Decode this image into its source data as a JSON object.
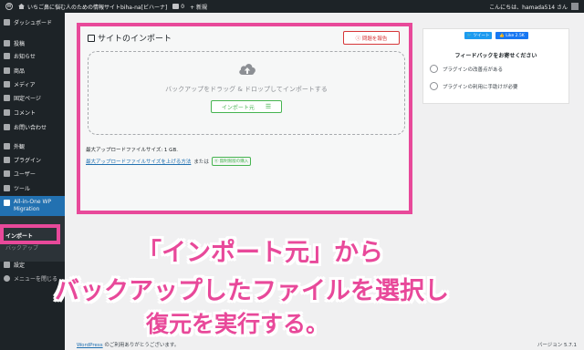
{
  "adminbar": {
    "site_name": "いちご鼻に悩む人のための情報サイトbiha-na[ビハーナ]",
    "comments_count": "0",
    "new_label": "+ 新規",
    "greeting": "こんにちは、hamada514 さん"
  },
  "sidebar": {
    "items": [
      {
        "label": "ダッシュボード"
      },
      {
        "label": "投稿"
      },
      {
        "label": "お知らせ"
      },
      {
        "label": "商品"
      },
      {
        "label": "メディア"
      },
      {
        "label": "固定ページ"
      },
      {
        "label": "コメント"
      },
      {
        "label": "お問い合わせ"
      },
      {
        "label": "外観"
      },
      {
        "label": "プラグイン"
      },
      {
        "label": "ユーザー"
      },
      {
        "label": "ツール"
      },
      {
        "label": "All-in-One WP Migration"
      }
    ],
    "submenu": {
      "import": "インポート",
      "backups": "バックアップ"
    },
    "settings": "設定",
    "collapse": "メニューを閉じる"
  },
  "main": {
    "title": "サイトのインポート",
    "report_button": "ⓘ 問題を報告",
    "drop_text": "バックアップをドラッグ & ドロップしてインポートする",
    "import_from_button": "インポート元",
    "max_size_text": "最大アップロードファイルサイズ: 1 GB.",
    "max_size_link": "最大アップロードファイルサイズを上げる方法",
    "or_text": "または",
    "unlimited_badge": "⓪ 無制限版の購入"
  },
  "feedback": {
    "tweet": "🐦 ツイート",
    "like": "👍 Like 2.5K",
    "title": "フィードバックをお寄せください",
    "options": [
      "プラグインの改善点がある",
      "プラグインの利用に手助けが必要"
    ]
  },
  "captions": {
    "line1": "「インポート元」から",
    "line2": "バックアップしたファイルを選択し",
    "line3": "復元を実行する。"
  },
  "footer": {
    "wordpress_link": "WordPress",
    "thanks": " のご利用ありがとうございます。",
    "version": "バージョン 5.7.1"
  },
  "colors": {
    "highlight": "#e8499a",
    "adminbar": "#1d2327",
    "import_green": "#46b450",
    "report_red": "#d63638"
  }
}
